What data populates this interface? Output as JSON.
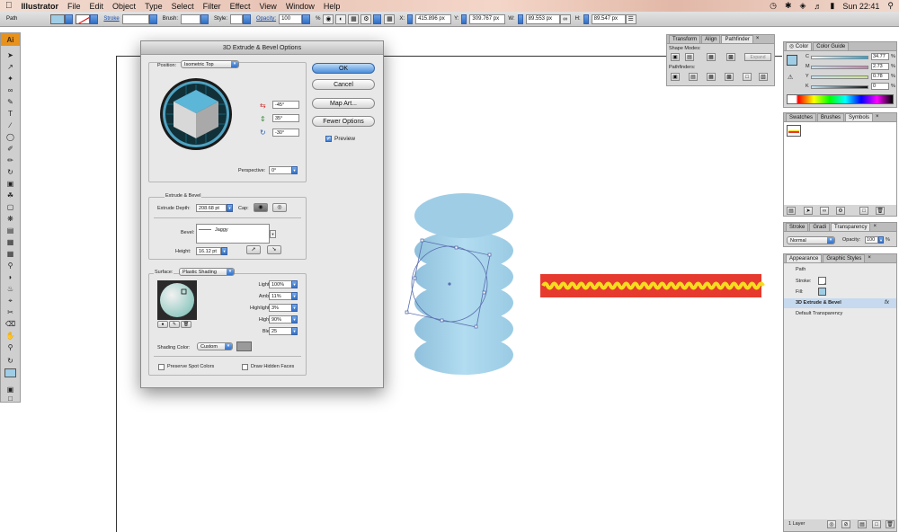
{
  "menubar": {
    "app": "Illustrator",
    "items": [
      "File",
      "Edit",
      "Object",
      "Type",
      "Select",
      "Filter",
      "Effect",
      "View",
      "Window",
      "Help"
    ],
    "clock": "Sun 22:41"
  },
  "control": {
    "object_type": "Path",
    "stroke_label": "Stroke",
    "brush_label": "Brush:",
    "style_label": "Style:",
    "opacity_label": "Opacity:",
    "opacity_value": "100",
    "opacity_unit": "%",
    "x_label": "X:",
    "x_value": "415.896 px",
    "y_label": "Y:",
    "y_value": "309.767 px",
    "w_label": "W:",
    "w_value": "89.553 px",
    "h_label": "H:",
    "h_value": "89.547 px"
  },
  "tools": {
    "logo": "Ai"
  },
  "dialog": {
    "title": "3D Extrude & Bevel Options",
    "position_label": "Position:",
    "position_value": "Isometric Top",
    "rot_x": "-45°",
    "rot_y": "35°",
    "rot_z": "-30°",
    "perspective_label": "Perspective:",
    "perspective_value": "0°",
    "ok": "OK",
    "cancel": "Cancel",
    "map_art": "Map Art...",
    "fewer_options": "Fewer Options",
    "preview_label": "Preview",
    "preview_checked": true,
    "extrude_group": "Extrude & Bevel",
    "extrude_depth_label": "Extrude Depth:",
    "extrude_depth_value": "208.68 pt",
    "cap_label": "Cap:",
    "bevel_label": "Bevel:",
    "bevel_value": "Jaggy",
    "height_label": "Height:",
    "height_value": "16.12 pt",
    "surface_label": "Surface:",
    "surface_value": "Plastic Shading",
    "light_intensity_label": "Light Intensity:",
    "light_intensity_value": "100%",
    "ambient_light_label": "Ambient Light:",
    "ambient_light_value": "11%",
    "highlight_intensity_label": "Highlight Intensity:",
    "highlight_intensity_value": "3%",
    "highlight_size_label": "Highlight Size:",
    "highlight_size_value": "90%",
    "blend_steps_label": "Blend Steps:",
    "blend_steps_value": "25",
    "shading_color_label": "Shading Color:",
    "shading_color_value": "Custom",
    "preserve_spot_label": "Preserve Spot Colors",
    "draw_hidden_label": "Draw Hidden Faces"
  },
  "pathfinder_panel": {
    "tabs": [
      "Transform",
      "Align",
      "Pathfinder"
    ],
    "shape_modes_label": "Shape Modes:",
    "expand_label": "Expand",
    "pathfinders_label": "Pathfinders:"
  },
  "color_panel": {
    "tabs": [
      "Color",
      "Color Guide"
    ],
    "channels": [
      {
        "label": "C",
        "value": "34.77",
        "color": "#00aeef"
      },
      {
        "label": "M",
        "value": "2.73",
        "color": "#ec008c"
      },
      {
        "label": "Y",
        "value": "0.78",
        "color": "#fff200"
      },
      {
        "label": "K",
        "value": "0",
        "color": "#231f20"
      }
    ],
    "unit": "%"
  },
  "swatches_panel": {
    "tabs": [
      "Swatches",
      "Brushes",
      "Symbols"
    ]
  },
  "transparency_panel": {
    "tabs": [
      "Stroke",
      "Gradi",
      "Transparency"
    ],
    "blend_mode": "Normal",
    "opacity_label": "Opacity:",
    "opacity_value": "100",
    "opacity_unit": "%"
  },
  "appearance_panel": {
    "tabs": [
      "Appearance",
      "Graphic Styles"
    ],
    "title": "Path",
    "rows": [
      "Stroke:",
      "Fill:",
      "3D Extrude & Bevel",
      "Default Transparency"
    ],
    "fx": "fx",
    "layers": "1 Layer"
  },
  "colors": {
    "accent": "#3d7ed3",
    "shape_blue": "#9fcde6",
    "stroke_red": "#e63a2e",
    "stroke_yellow": "#f6dc1e"
  }
}
